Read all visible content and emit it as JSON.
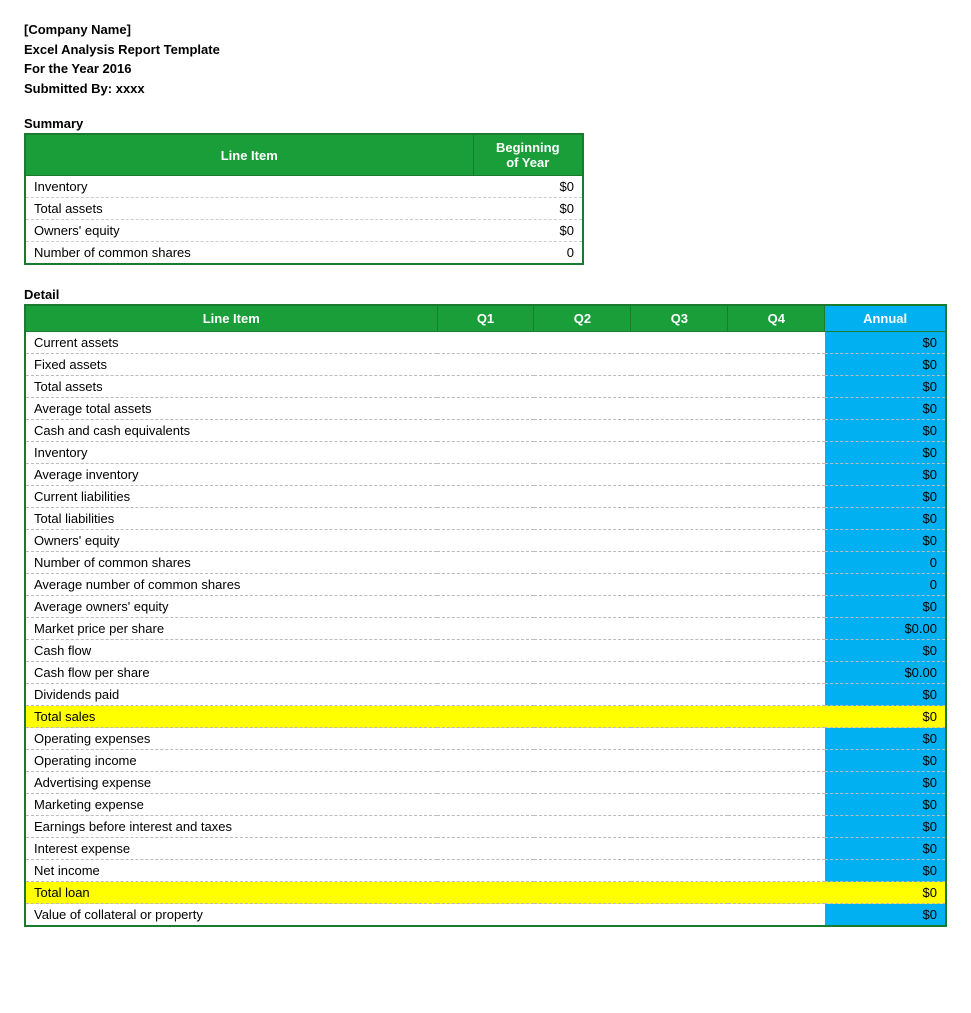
{
  "header": {
    "company": "[Company Name]",
    "title": "Excel Analysis Report Template",
    "year": "For the Year 2016",
    "submitted": "Submitted By:  xxxx"
  },
  "summary": {
    "label": "Summary",
    "columns": [
      "Line Item",
      "Beginning of Year"
    ],
    "rows": [
      {
        "item": "Inventory",
        "value": "$0"
      },
      {
        "item": "Total assets",
        "value": "$0"
      },
      {
        "item": "Owners' equity",
        "value": "$0"
      },
      {
        "item": "Number of common shares",
        "value": "0"
      }
    ]
  },
  "detail": {
    "label": "Detail",
    "columns": [
      "Line Item",
      "Q1",
      "Q2",
      "Q3",
      "Q4",
      "Annual"
    ],
    "rows": [
      {
        "item": "Current assets",
        "q1": "",
        "q2": "",
        "q3": "",
        "q4": "",
        "annual": "$0",
        "type": "normal"
      },
      {
        "item": "Fixed assets",
        "q1": "",
        "q2": "",
        "q3": "",
        "q4": "",
        "annual": "$0",
        "type": "normal"
      },
      {
        "item": "Total assets",
        "q1": "",
        "q2": "",
        "q3": "",
        "q4": "",
        "annual": "$0",
        "type": "normal"
      },
      {
        "item": "Average total assets",
        "q1": "",
        "q2": "",
        "q3": "",
        "q4": "",
        "annual": "$0",
        "type": "normal"
      },
      {
        "item": "Cash and cash equivalents",
        "q1": "",
        "q2": "",
        "q3": "",
        "q4": "",
        "annual": "$0",
        "type": "normal"
      },
      {
        "item": "Inventory",
        "q1": "",
        "q2": "",
        "q3": "",
        "q4": "",
        "annual": "$0",
        "type": "normal"
      },
      {
        "item": "Average inventory",
        "q1": "",
        "q2": "",
        "q3": "",
        "q4": "",
        "annual": "$0",
        "type": "normal"
      },
      {
        "item": "Current liabilities",
        "q1": "",
        "q2": "",
        "q3": "",
        "q4": "",
        "annual": "$0",
        "type": "normal"
      },
      {
        "item": "Total liabilities",
        "q1": "",
        "q2": "",
        "q3": "",
        "q4": "",
        "annual": "$0",
        "type": "normal"
      },
      {
        "item": "Owners' equity",
        "q1": "",
        "q2": "",
        "q3": "",
        "q4": "",
        "annual": "$0",
        "type": "normal"
      },
      {
        "item": "Number of common shares",
        "q1": "",
        "q2": "",
        "q3": "",
        "q4": "",
        "annual": "0",
        "type": "normal"
      },
      {
        "item": "Average number of common shares",
        "q1": "",
        "q2": "",
        "q3": "",
        "q4": "",
        "annual": "0",
        "type": "normal"
      },
      {
        "item": "Average owners' equity",
        "q1": "",
        "q2": "",
        "q3": "",
        "q4": "",
        "annual": "$0",
        "type": "normal"
      },
      {
        "item": "Market price per share",
        "q1": "",
        "q2": "",
        "q3": "",
        "q4": "",
        "annual": "$0.00",
        "type": "normal"
      },
      {
        "item": "Cash flow",
        "q1": "",
        "q2": "",
        "q3": "",
        "q4": "",
        "annual": "$0",
        "type": "normal"
      },
      {
        "item": "Cash flow per share",
        "q1": "",
        "q2": "",
        "q3": "",
        "q4": "",
        "annual": "$0.00",
        "type": "normal"
      },
      {
        "item": "Dividends paid",
        "q1": "",
        "q2": "",
        "q3": "",
        "q4": "",
        "annual": "$0",
        "type": "normal"
      },
      {
        "item": "Total sales",
        "q1": "",
        "q2": "",
        "q3": "",
        "q4": "",
        "annual": "$0",
        "type": "total-sales"
      },
      {
        "item": "Operating expenses",
        "q1": "",
        "q2": "",
        "q3": "",
        "q4": "",
        "annual": "$0",
        "type": "normal"
      },
      {
        "item": "Operating income",
        "q1": "",
        "q2": "",
        "q3": "",
        "q4": "",
        "annual": "$0",
        "type": "normal"
      },
      {
        "item": "Advertising expense",
        "q1": "",
        "q2": "",
        "q3": "",
        "q4": "",
        "annual": "$0",
        "type": "normal"
      },
      {
        "item": "Marketing expense",
        "q1": "",
        "q2": "",
        "q3": "",
        "q4": "",
        "annual": "$0",
        "type": "normal"
      },
      {
        "item": "Earnings before interest and taxes",
        "q1": "",
        "q2": "",
        "q3": "",
        "q4": "",
        "annual": "$0",
        "type": "normal"
      },
      {
        "item": "Interest expense",
        "q1": "",
        "q2": "",
        "q3": "",
        "q4": "",
        "annual": "$0",
        "type": "normal"
      },
      {
        "item": "Net income",
        "q1": "",
        "q2": "",
        "q3": "",
        "q4": "",
        "annual": "$0",
        "type": "normal"
      },
      {
        "item": "Total loan",
        "q1": "",
        "q2": "",
        "q3": "",
        "q4": "",
        "annual": "$0",
        "type": "total-loan"
      },
      {
        "item": "Value of collateral or property",
        "q1": "",
        "q2": "",
        "q3": "",
        "q4": "",
        "annual": "$0",
        "type": "normal"
      }
    ]
  }
}
